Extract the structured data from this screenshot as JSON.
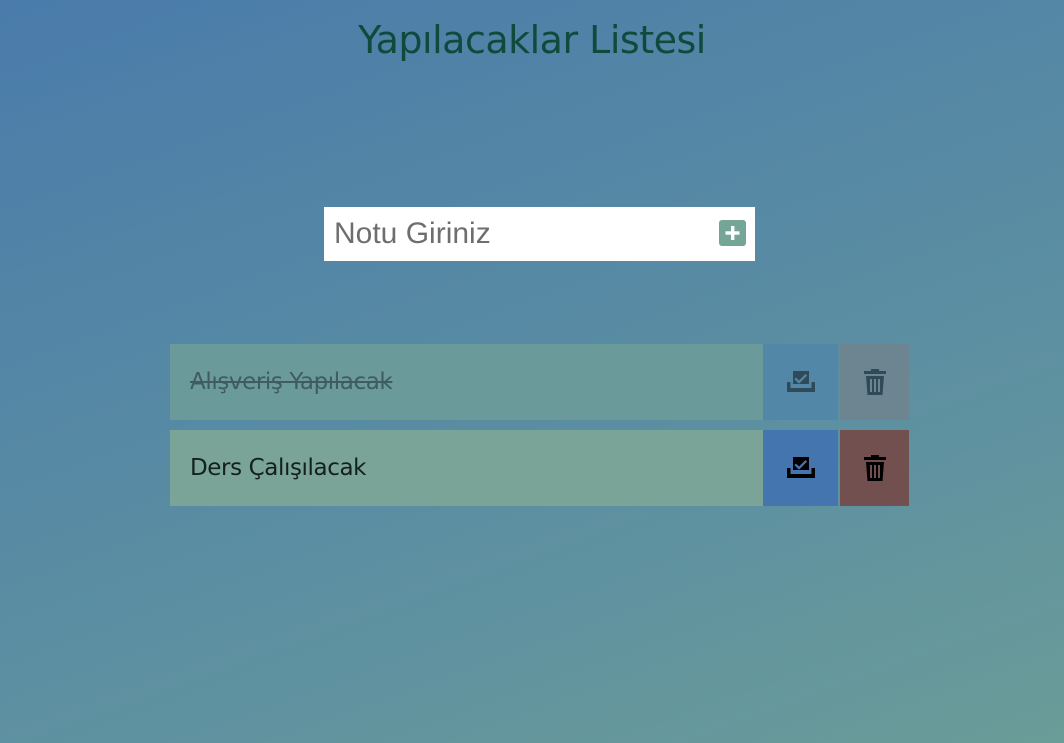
{
  "header": {
    "title": "Yapılacaklar Listesi"
  },
  "input": {
    "placeholder": "Notu Giriniz",
    "value": "",
    "add_icon": "plus-square-icon"
  },
  "todos": [
    {
      "text": "Alışveriş Yapılacak",
      "completed": true,
      "complete_icon": "inbox-check-icon",
      "delete_icon": "trash-icon"
    },
    {
      "text": "Ders Çalışılacak",
      "completed": false,
      "complete_icon": "inbox-check-icon",
      "delete_icon": "trash-icon"
    }
  ],
  "colors": {
    "title": "#0f4a3c",
    "add_button": "#74a596",
    "complete_button": "#4575ae",
    "delete_button": "#72504f",
    "todo_background": "#79a497"
  }
}
